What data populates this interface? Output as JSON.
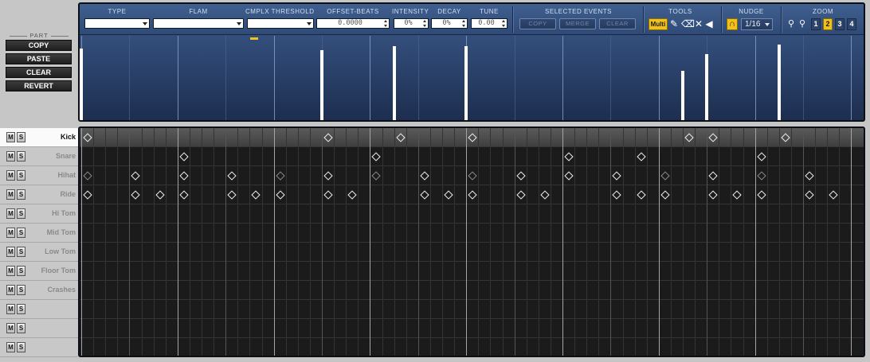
{
  "toolbar": {
    "type_label": "TYPE",
    "flam_label": "FLAM",
    "cmplx_label": "CMPLX THRESHOLD",
    "offset_label": "OFFSET-BEATS",
    "offset_value": "0.0000",
    "intensity_label": "INTENSITY",
    "intensity_value": "0%",
    "decay_label": "DECAY",
    "decay_value": "0%",
    "tune_label": "TUNE",
    "tune_value": "0.00",
    "selected_label": "SELECTED EVENTS",
    "copy_label": "COPY",
    "merge_label": "MERGE",
    "clear_label": "CLEAR",
    "tools_label": "TOOLS",
    "multi_label": "Multi",
    "nudge_label": "NUDGE",
    "nudge_value": "1/16",
    "zoom_label": "ZOOM",
    "zoom_levels": [
      "1",
      "2",
      "3",
      "4"
    ],
    "zoom_active": "2"
  },
  "part": {
    "title": "PART",
    "buttons": [
      "COPY",
      "PASTE",
      "CLEAR",
      "REVERT"
    ]
  },
  "tracks": [
    {
      "name": "Kick",
      "selected": true
    },
    {
      "name": "Snare"
    },
    {
      "name": "Hihat"
    },
    {
      "name": "Ride"
    },
    {
      "name": "Hi Tom"
    },
    {
      "name": "Mid Tom"
    },
    {
      "name": "Low Tom"
    },
    {
      "name": "Floor Tom"
    },
    {
      "name": "Crashes"
    },
    {
      "name": ""
    },
    {
      "name": ""
    },
    {
      "name": ""
    }
  ],
  "mute_label": "M",
  "solo_label": "S",
  "steps_total": 58,
  "step_hits": {
    "Kick": [
      0,
      20,
      26,
      32,
      50,
      52,
      58
    ],
    "Snare": [
      8,
      24,
      40,
      46,
      56
    ],
    "Hihat": [
      4,
      8,
      12,
      20,
      28,
      36,
      40,
      44,
      52,
      60
    ],
    "Hihat_ghost": [
      0,
      16,
      24,
      32,
      48,
      56
    ],
    "Ride": [
      0,
      4,
      6,
      8,
      12,
      14,
      16,
      20,
      22,
      28,
      30,
      32,
      36,
      38,
      44,
      46,
      48,
      52,
      54,
      56,
      60,
      62
    ]
  },
  "velocity_steps": [
    0,
    20,
    26,
    32,
    50,
    52,
    58
  ],
  "velocity_levels": [
    0.87,
    0.85,
    0.89,
    0.89,
    0.6,
    0.8,
    0.91
  ],
  "colors": {
    "accent": "#f2c21a",
    "panel_blue": "#2e4772"
  }
}
